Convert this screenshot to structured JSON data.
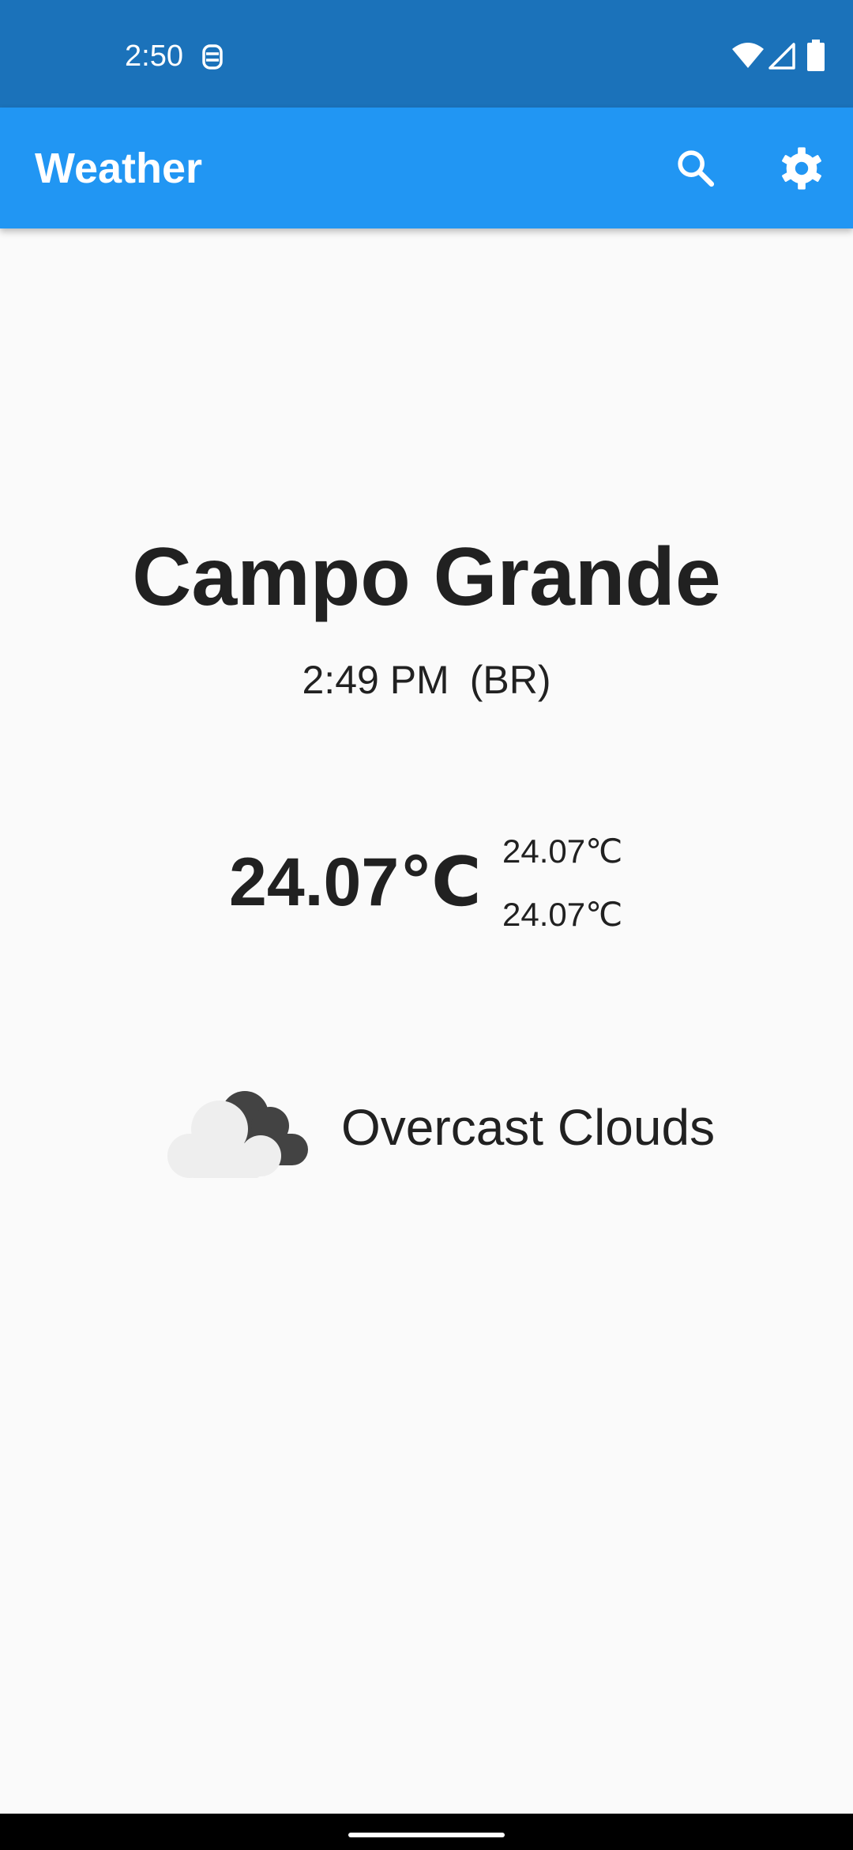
{
  "status_bar": {
    "time": "2:50",
    "notification_icon": "lock-rounded-icon",
    "icons": [
      "wifi-icon",
      "cell-signal-icon",
      "battery-icon"
    ],
    "background_color": "#1b72ba"
  },
  "app_bar": {
    "title": "Weather",
    "background_color": "#2196f3",
    "actions": [
      "search-icon",
      "settings-gear-icon"
    ]
  },
  "location": {
    "city": "Campo Grande",
    "local_time": "2:49 PM",
    "country_code": "(BR)"
  },
  "temperature": {
    "current": "24.07℃",
    "max": "24.07℃",
    "min": "24.07℃"
  },
  "condition": {
    "icon": "overcast-clouds-icon",
    "description": "Overcast Clouds"
  }
}
